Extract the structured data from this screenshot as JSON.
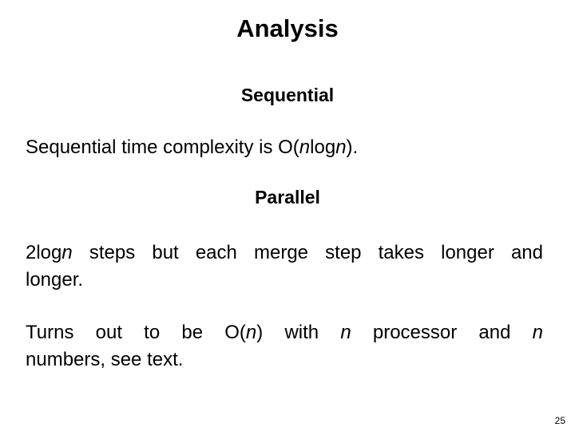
{
  "slide": {
    "title": "Analysis",
    "sections": [
      {
        "heading": "Sequential",
        "paragraph": {
          "pre": "Sequential time complexity is O(",
          "i1": "n",
          "mid": "log",
          "i2": "n",
          "post": ")."
        }
      },
      {
        "heading": "Parallel",
        "paragraph1": {
          "pre": "2log",
          "i1": "n",
          "line1_rest": " steps but each merge step takes  longer and",
          "line2": "longer."
        },
        "paragraph2": {
          "a": "Turns out to be O(",
          "i1": "n",
          "b": ") with ",
          "i2": "n",
          "c": " processor and ",
          "i3": "n",
          "line2": "numbers, see text."
        }
      }
    ],
    "page_number": "25"
  }
}
